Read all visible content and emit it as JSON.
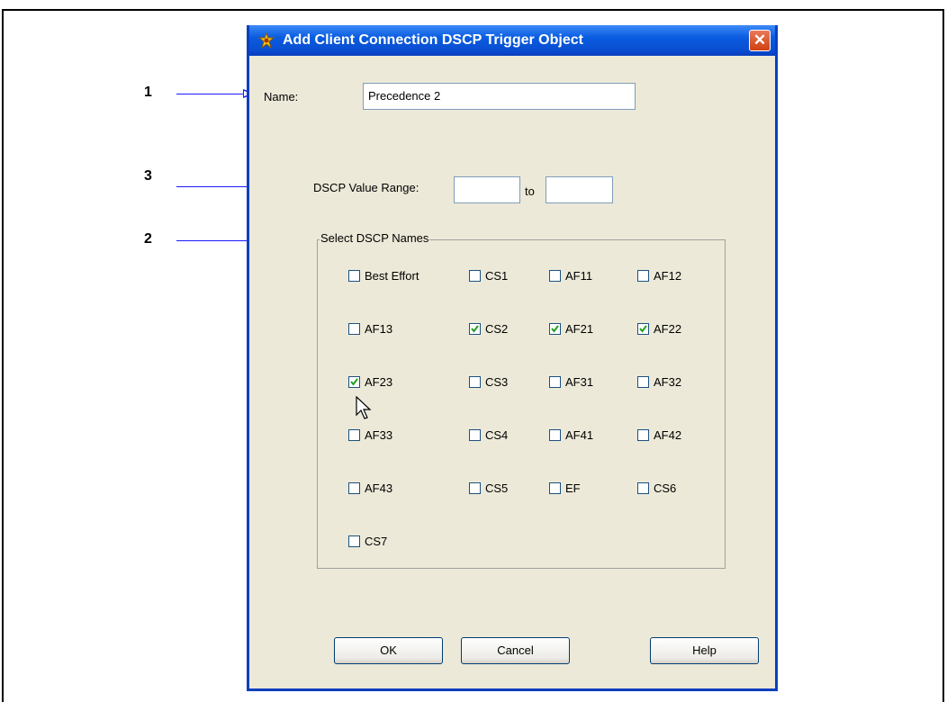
{
  "callouts": [
    {
      "number": "1"
    },
    {
      "number": "3"
    },
    {
      "number": "2"
    }
  ],
  "dialog": {
    "title": "Add Client Connection DSCP Trigger Object",
    "close_glyph": "✕",
    "icon": "shield-icon",
    "name_label": "Name:",
    "name_value": "Precedence 2",
    "range_label": "DSCP Value Range:",
    "range_from": "",
    "range_to_label": "to",
    "range_to": "",
    "group_title": "Select DSCP Names",
    "checkboxes": [
      {
        "label": "Best Effort",
        "checked": false
      },
      {
        "label": "CS1",
        "checked": false
      },
      {
        "label": "AF11",
        "checked": false
      },
      {
        "label": "AF12",
        "checked": false
      },
      {
        "label": "AF13",
        "checked": false
      },
      {
        "label": "CS2",
        "checked": true
      },
      {
        "label": "AF21",
        "checked": true
      },
      {
        "label": "AF22",
        "checked": true
      },
      {
        "label": "AF23",
        "checked": true
      },
      {
        "label": "CS3",
        "checked": false
      },
      {
        "label": "AF31",
        "checked": false
      },
      {
        "label": "AF32",
        "checked": false
      },
      {
        "label": "AF33",
        "checked": false
      },
      {
        "label": "CS4",
        "checked": false
      },
      {
        "label": "AF41",
        "checked": false
      },
      {
        "label": "AF42",
        "checked": false
      },
      {
        "label": "AF43",
        "checked": false
      },
      {
        "label": "CS5",
        "checked": false
      },
      {
        "label": "EF",
        "checked": false
      },
      {
        "label": "CS6",
        "checked": false
      },
      {
        "label": "CS7",
        "checked": false
      }
    ],
    "buttons": {
      "ok": "OK",
      "cancel": "Cancel",
      "help": "Help"
    }
  },
  "colors": {
    "title_bar": "#0a4ed1",
    "callout_arrow": "#1a1aff",
    "check": "#21a121"
  }
}
